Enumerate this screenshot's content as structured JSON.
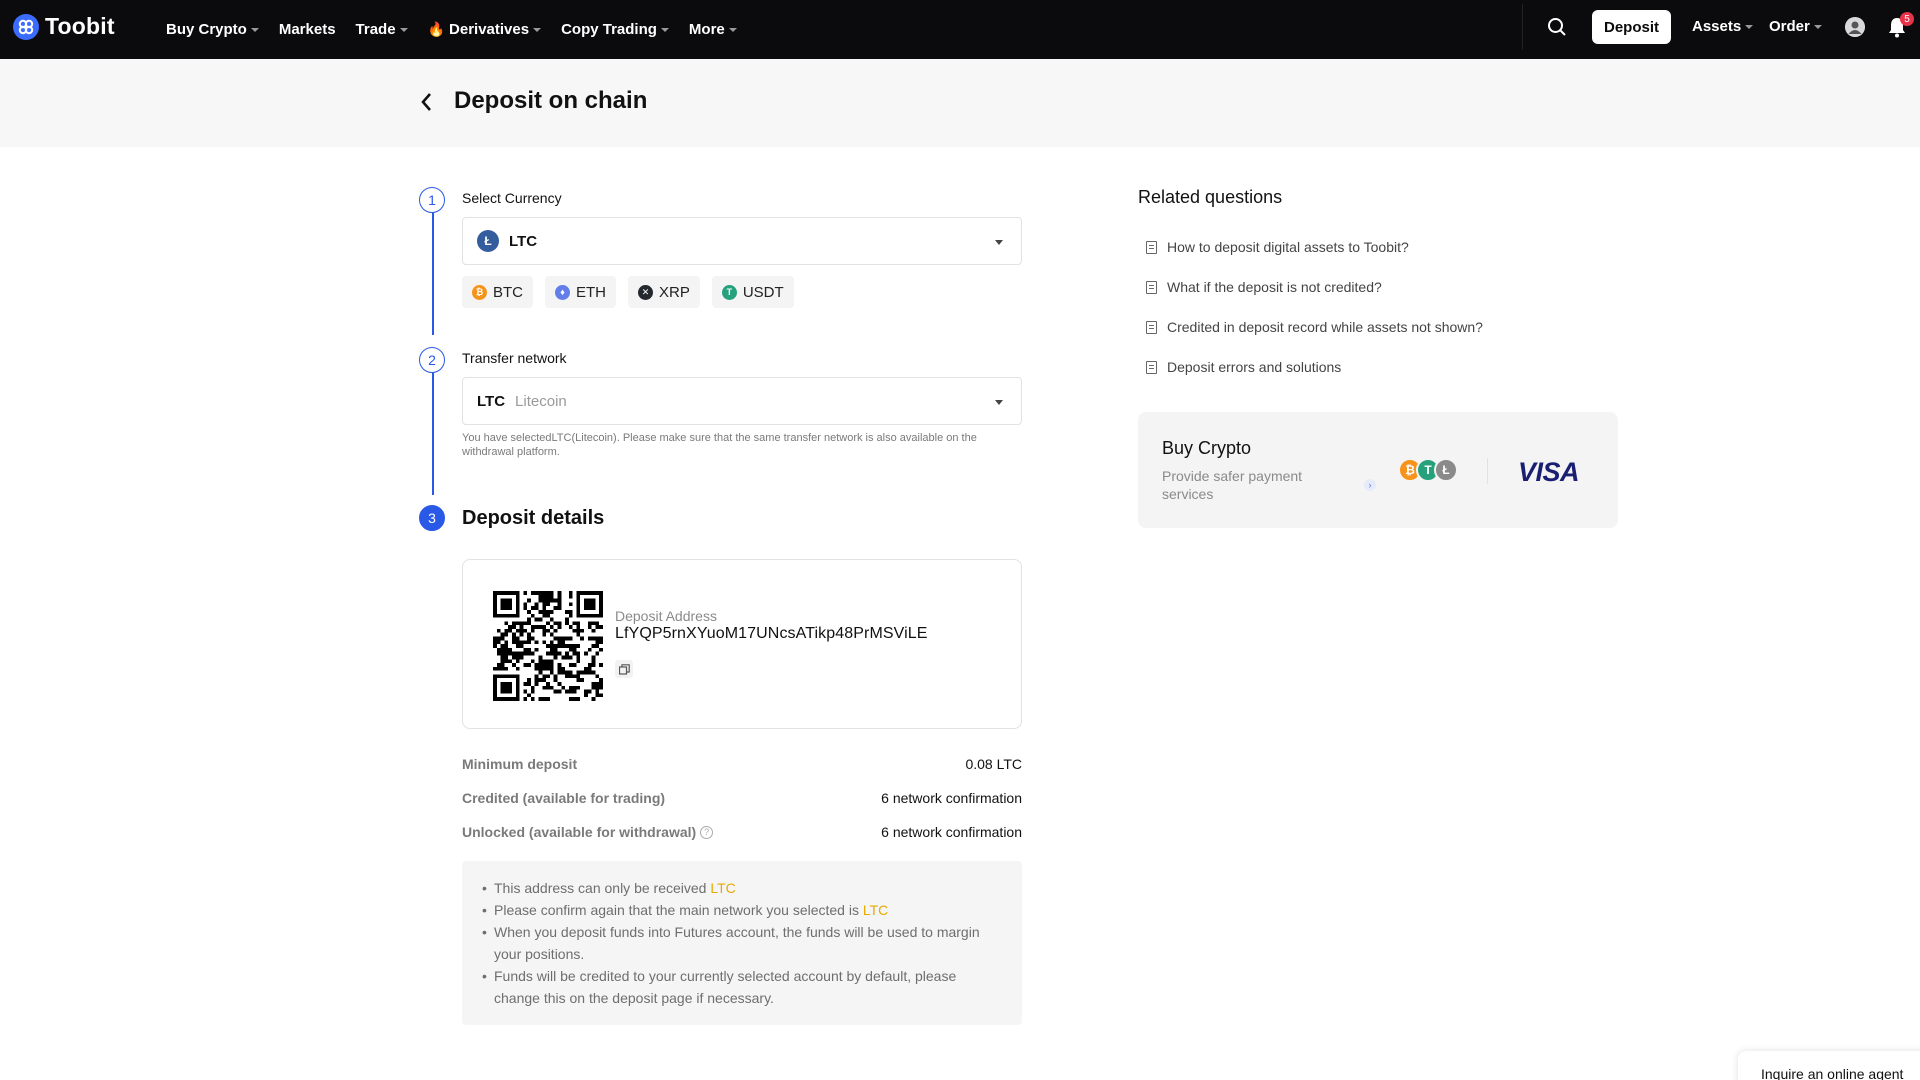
{
  "brand": {
    "name": "Toobit",
    "accent": "#2a59e8"
  },
  "nav": {
    "items": [
      {
        "label": "Buy Crypto",
        "dropdown": true
      },
      {
        "label": "Markets",
        "dropdown": false
      },
      {
        "label": "Trade",
        "dropdown": true
      },
      {
        "label": "Derivatives",
        "dropdown": true,
        "icon": "fire-icon"
      },
      {
        "label": "Copy Trading",
        "dropdown": true
      },
      {
        "label": "More",
        "dropdown": true
      }
    ],
    "deposit_label": "Deposit",
    "assets_label": "Assets",
    "order_label": "Order",
    "notification_count": "5"
  },
  "page": {
    "title": "Deposit on chain"
  },
  "steps": {
    "one": {
      "num": "1",
      "label": "Select Currency"
    },
    "two": {
      "num": "2",
      "label": "Transfer network"
    },
    "three": {
      "num": "3",
      "label": "Deposit details"
    }
  },
  "currency": {
    "selected": "LTC",
    "quick": [
      {
        "symbol": "BTC",
        "color": "#f7931a",
        "glyph": "₿"
      },
      {
        "symbol": "ETH",
        "color": "#627eea",
        "glyph": "♦"
      },
      {
        "symbol": "XRP",
        "color": "#23292f",
        "glyph": "✕"
      },
      {
        "symbol": "USDT",
        "color": "#26a17b",
        "glyph": "T"
      }
    ]
  },
  "network": {
    "code": "LTC",
    "name": "Litecoin",
    "note": "You have selectedLTC(Litecoin). Please make sure that the same transfer network is also available on the withdrawal platform."
  },
  "deposit": {
    "address_label": "Deposit Address",
    "address": "LfYQP5rnXYuoM17UNcsATikp48PrMSViLE",
    "rows": [
      {
        "key": "Minimum deposit",
        "value": "0.08 LTC",
        "help": false
      },
      {
        "key": "Credited (available for trading)",
        "value": "6 network confirmation",
        "help": false
      },
      {
        "key": "Unlocked (available for withdrawal)",
        "value": "6 network confirmation",
        "help": true
      }
    ],
    "tips": {
      "t1_text": "This address can only be received ",
      "t1_hl": "LTC",
      "t2_text": "Please confirm again that the main network you selected is ",
      "t2_hl": "LTC",
      "t3": "When you deposit funds into Futures account, the funds will be used to margin your positions.",
      "t4": "Funds will be credited to your currently selected account by default, please change this on the deposit page if necessary."
    }
  },
  "related": {
    "title": "Related questions",
    "items": [
      "How to deposit digital assets to Toobit?",
      "What if the deposit is not credited?",
      "Credited in deposit record while assets not shown?",
      "Deposit errors and solutions"
    ]
  },
  "buy_card": {
    "title": "Buy Crypto",
    "subtitle": "Provide safer payment services",
    "visa": "VISA"
  },
  "chat": {
    "label": "Inquire an online agent"
  }
}
